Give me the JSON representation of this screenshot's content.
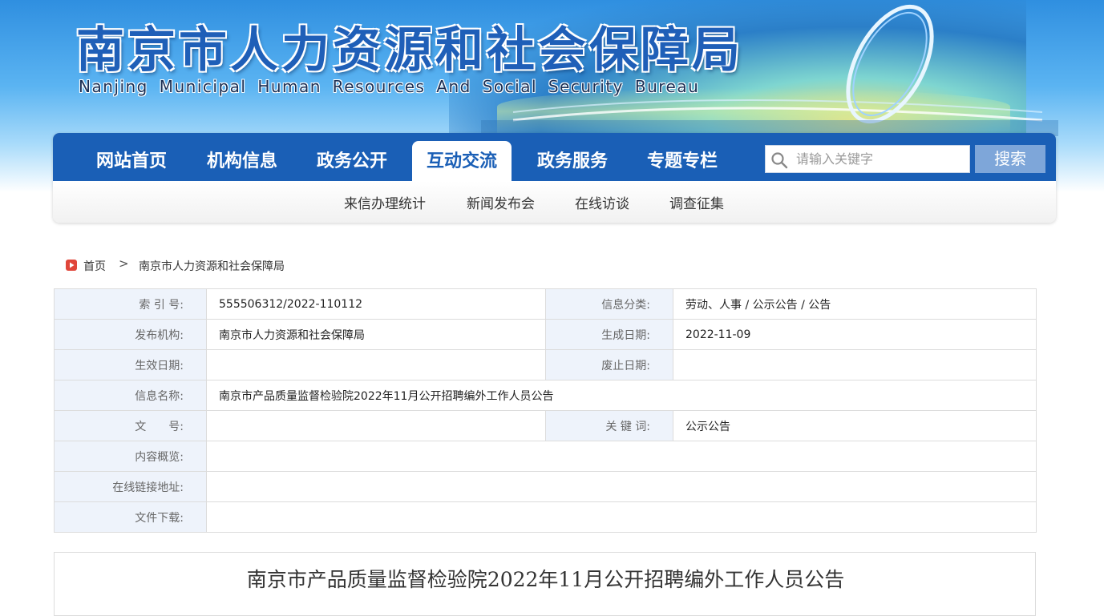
{
  "header": {
    "title_cn": "南京市人力资源和社会保障局",
    "title_en": "Nanjing Municipal Human Resources And Social Security Bureau"
  },
  "nav": {
    "items": [
      {
        "label": "网站首页"
      },
      {
        "label": "机构信息"
      },
      {
        "label": "政务公开"
      },
      {
        "label": "互动交流",
        "active": true
      },
      {
        "label": "政务服务"
      },
      {
        "label": "专题专栏"
      }
    ],
    "search_placeholder": "请输入关键字",
    "search_button": "搜索"
  },
  "sub_nav": {
    "items": [
      {
        "label": "来信办理统计"
      },
      {
        "label": "新闻发布会"
      },
      {
        "label": "在线访谈"
      },
      {
        "label": "调查征集"
      }
    ]
  },
  "breadcrumb": {
    "home": "首页",
    "separator": ">",
    "current": "南京市人力资源和社会保障局"
  },
  "info": {
    "index_no_label": "索 引 号:",
    "index_no": "555506312/2022-110112",
    "category_label": "信息分类:",
    "category": "劳动、人事 / 公示公告 / 公告",
    "publisher_label": "发布机构:",
    "publisher": "南京市人力资源和社会保障局",
    "created_label": "生成日期:",
    "created": "2022-11-09",
    "effective_label": "生效日期:",
    "effective": "",
    "abolished_label": "废止日期:",
    "abolished": "",
    "name_label": "信息名称:",
    "name": "南京市产品质量监督检验院2022年11月公开招聘编外工作人员公告",
    "doc_no_label": "文　　号:",
    "doc_no": "",
    "keywords_label": "关 键 词:",
    "keywords": "公示公告",
    "summary_label": "内容概览:",
    "summary": "",
    "link_label": "在线链接地址:",
    "link": "",
    "download_label": "文件下载:",
    "download": ""
  },
  "article": {
    "title": "南京市产品质量监督检验院2022年11月公开招聘编外工作人员公告"
  },
  "colors": {
    "nav_blue": "#1a5fb6",
    "search_button": "#7ea6d9",
    "label_bg": "#eef3fb",
    "breadcrumb_icon": "#e0463a"
  }
}
